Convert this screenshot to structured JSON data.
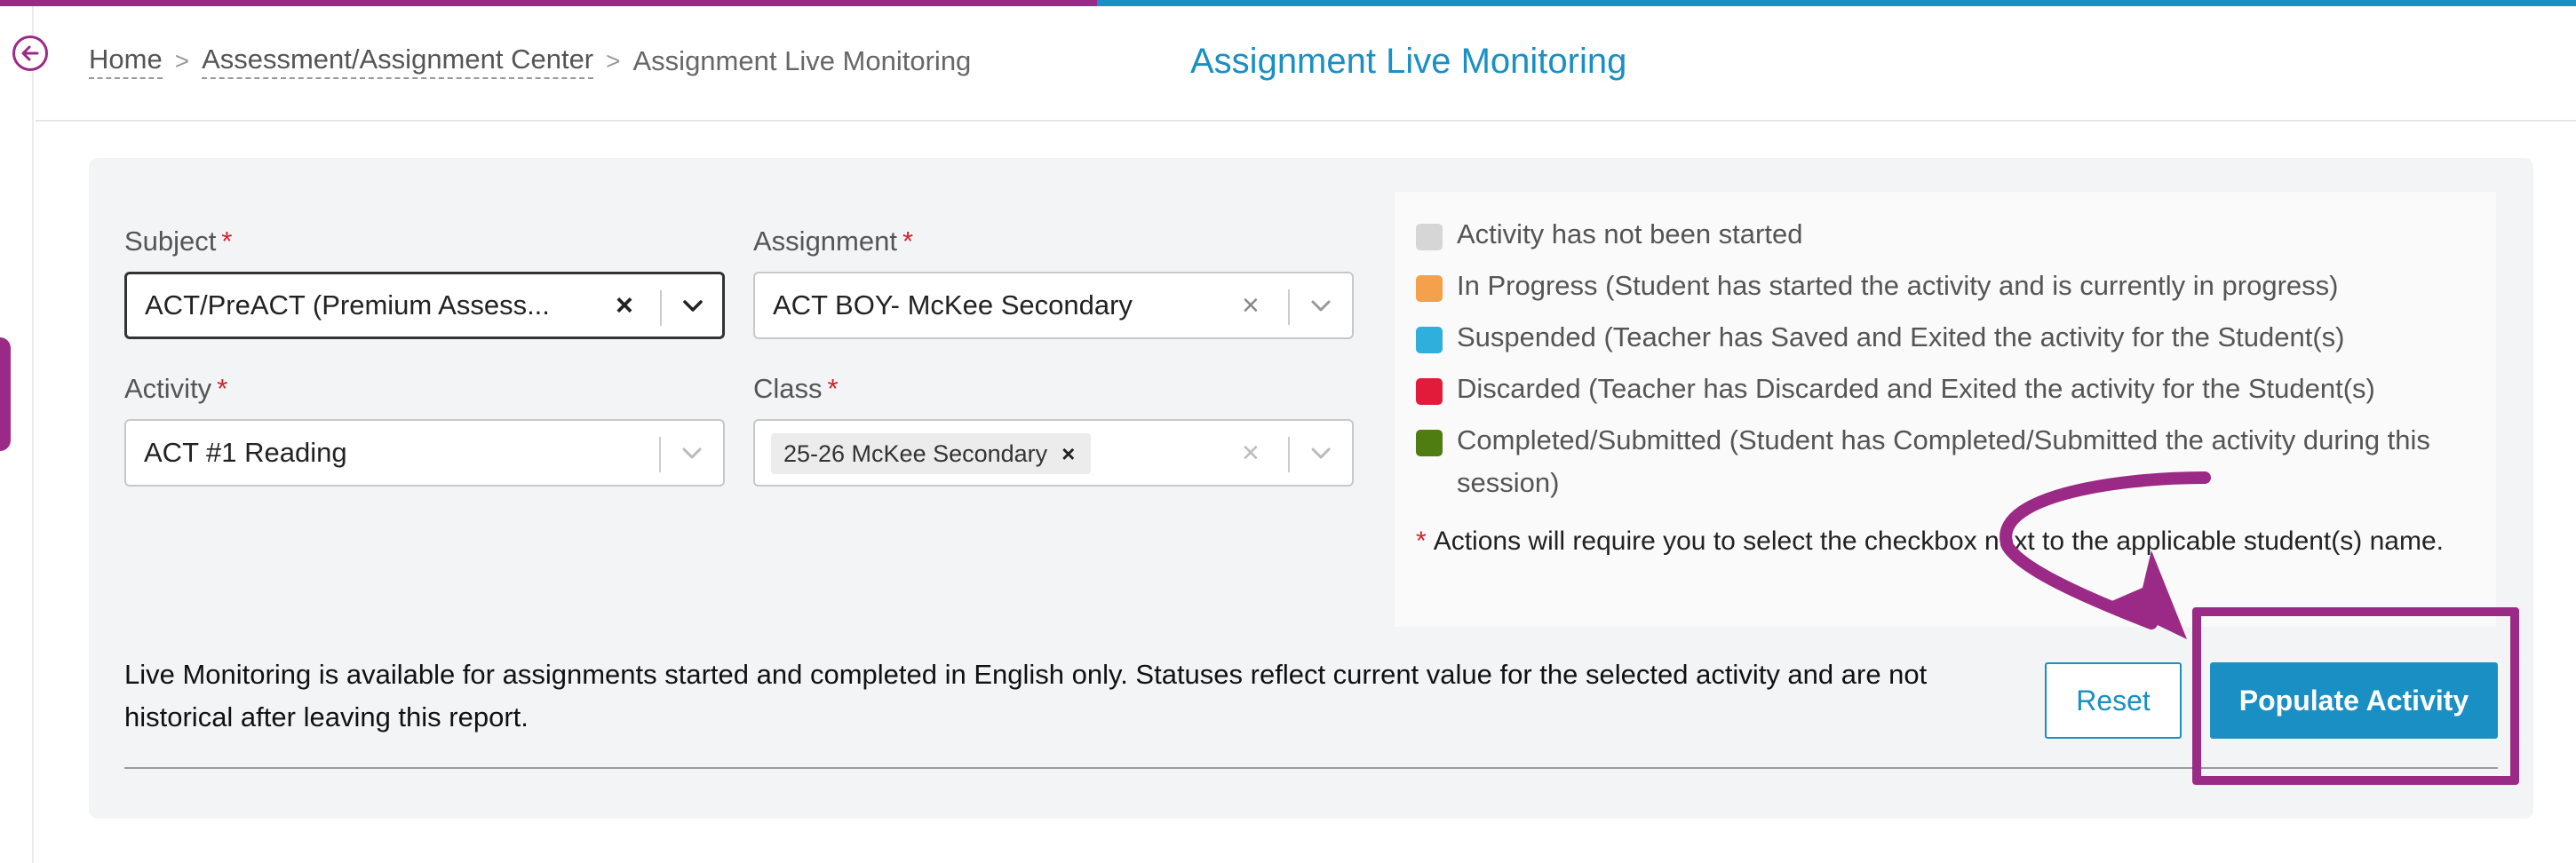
{
  "colors": {
    "magenta": "#9b2a86",
    "accent_blue": "#1a8fc4",
    "status_not_started": "#d6d6d6",
    "status_in_progress": "#f5a04a",
    "status_suspended": "#2fb0dc",
    "status_discarded": "#e31b3b",
    "status_completed": "#4f7d12"
  },
  "nav": {
    "back_icon": "arrow-left-circle-icon"
  },
  "breadcrumb": {
    "home": "Home",
    "center": "Assessment/Assignment Center",
    "current": "Assignment Live Monitoring",
    "separator": ">"
  },
  "page_title": "Assignment Live Monitoring",
  "form": {
    "required_mark": "*",
    "subject": {
      "label": "Subject",
      "value": "ACT/PreACT (Premium Assess..."
    },
    "assignment": {
      "label": "Assignment",
      "value": "ACT BOY- McKee Secondary"
    },
    "activity": {
      "label": "Activity",
      "value": "ACT #1 Reading"
    },
    "class": {
      "label": "Class",
      "tag": "25-26 McKee Secondary"
    },
    "clear_glyph": "×",
    "tag_remove_glyph": "×"
  },
  "legend": {
    "items": [
      {
        "text": "Activity has not been started"
      },
      {
        "text": "In Progress (Student has started the activity and is currently in progress)"
      },
      {
        "text": "Suspended (Teacher has Saved and Exited the activity for the Student(s)"
      },
      {
        "text": "Discarded (Teacher has Discarded and Exited the activity for the Student(s)"
      },
      {
        "text": "Completed/Submitted (Student has Completed/Submitted the activity during this session)"
      }
    ],
    "note_star": "*",
    "note": "Actions will require you to select the checkbox next to the applicable student(s) name."
  },
  "info_text": "Live Monitoring is available for assignments started and completed in English only. Statuses reflect current value for the selected activity and are not historical after leaving this report.",
  "buttons": {
    "reset": "Reset",
    "populate": "Populate Activity"
  }
}
